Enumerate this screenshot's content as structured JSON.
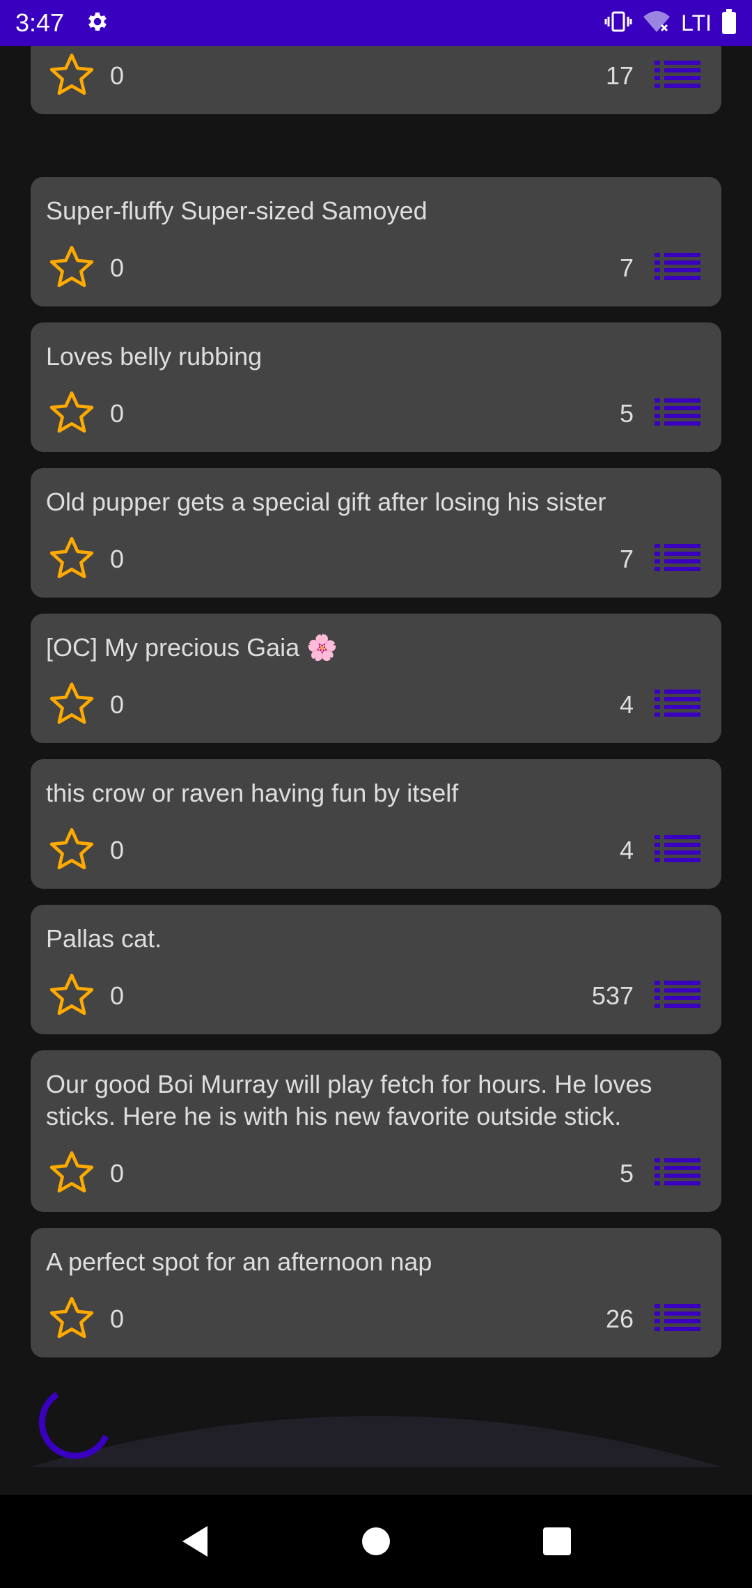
{
  "status_bar": {
    "time": "3:47",
    "network_label": "LTI",
    "color": "#3a00c0"
  },
  "colors": {
    "star": "#ffaa00",
    "list_icon": "#3a00c0",
    "card_bg": "#444444",
    "page_bg": "#141414"
  },
  "posts": [
    {
      "title": "",
      "favorites": "0",
      "comments": "17"
    },
    {
      "title": "Super-fluffy Super-sized Samoyed",
      "favorites": "0",
      "comments": "7"
    },
    {
      "title": "Loves belly rubbing",
      "favorites": "0",
      "comments": "5"
    },
    {
      "title": "Old pupper gets a special gift after losing his sister",
      "favorites": "0",
      "comments": "7"
    },
    {
      "title": "[OC] My precious Gaia 🌸",
      "favorites": "0",
      "comments": "4"
    },
    {
      "title": "this crow or raven having fun by itself",
      "favorites": "0",
      "comments": "4"
    },
    {
      "title": "Pallas cat.",
      "favorites": "0",
      "comments": "537"
    },
    {
      "title": "Our good Boi Murray will play fetch for hours. He loves sticks. Here he is with his new favorite outside stick.",
      "favorites": "0",
      "comments": "5"
    },
    {
      "title": "A perfect spot for an afternoon nap",
      "favorites": "0",
      "comments": "26"
    }
  ],
  "icons": {
    "settings": "gear-icon",
    "vibrate": "vibrate-icon",
    "wifi": "wifi-icon",
    "battery": "battery-icon",
    "favorite": "star-outline-icon",
    "details": "list-icon",
    "back": "back-icon",
    "home": "home-icon",
    "recents": "recents-icon"
  }
}
